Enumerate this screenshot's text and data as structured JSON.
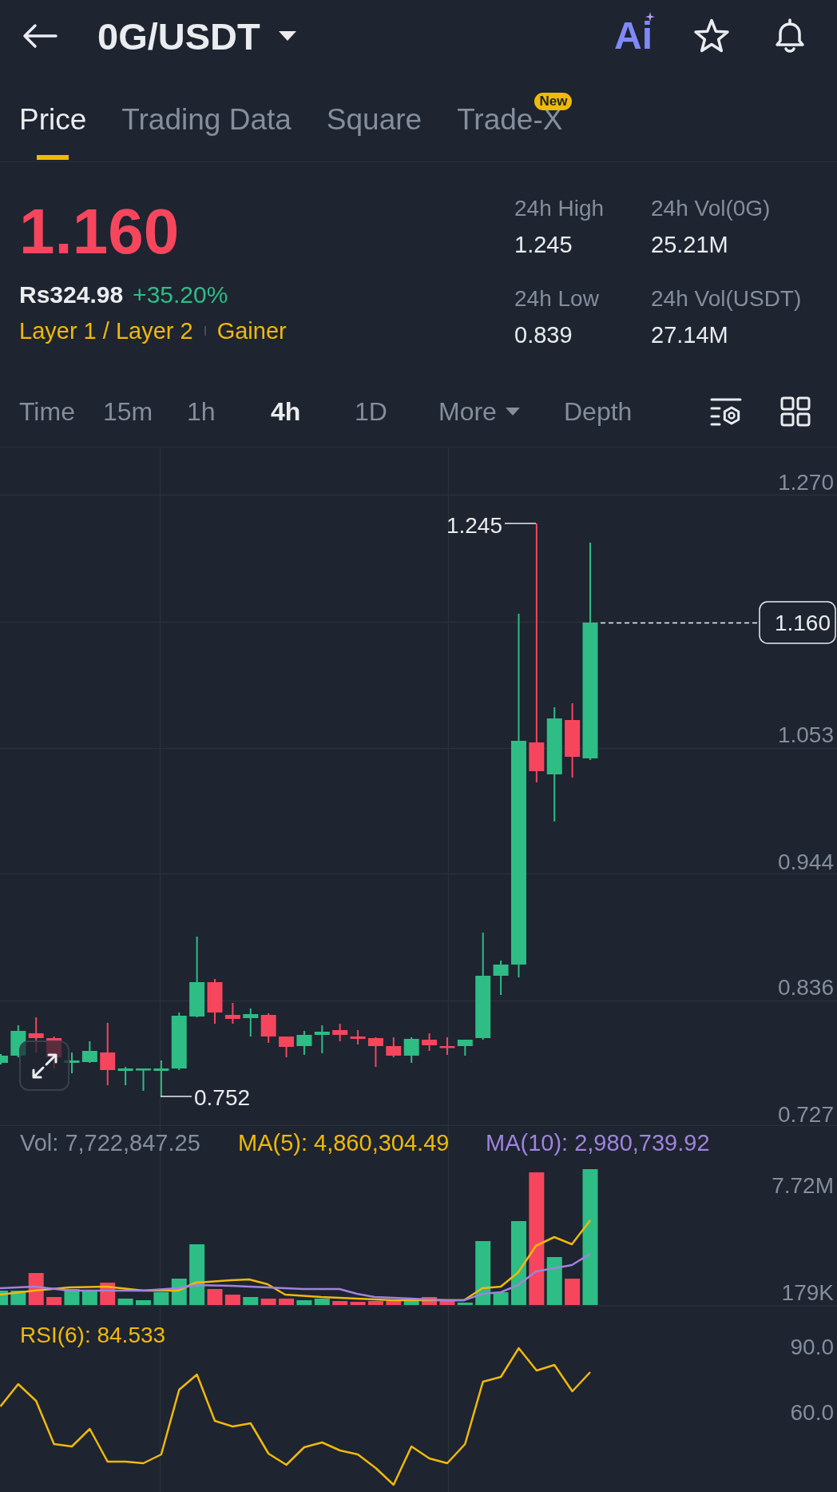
{
  "header": {
    "title": "0G/USDT",
    "ai_label": "Ai"
  },
  "tabs": [
    {
      "label": "Price",
      "selected": true
    },
    {
      "label": "Trading Data",
      "selected": false
    },
    {
      "label": "Square",
      "selected": false
    },
    {
      "label": "Trade-X",
      "selected": false,
      "badge": "New"
    }
  ],
  "ticker": {
    "price": "1.160",
    "local_price": "Rs324.98",
    "change": "+35.20%",
    "tags": [
      "Layer 1 / Layer 2",
      "Gainer"
    ],
    "stats": [
      {
        "label": "24h High",
        "value": "1.245"
      },
      {
        "label": "24h Vol(0G)",
        "value": "25.21M"
      },
      {
        "label": "24h Low",
        "value": "0.839"
      },
      {
        "label": "24h Vol(USDT)",
        "value": "27.14M"
      }
    ]
  },
  "intervals": [
    {
      "label": "Time",
      "kind": "option",
      "selected": false
    },
    {
      "label": "15m",
      "kind": "option",
      "selected": false
    },
    {
      "label": "1h",
      "kind": "option",
      "selected": false
    },
    {
      "label": "4h",
      "kind": "option",
      "selected": true
    },
    {
      "label": "1D",
      "kind": "option",
      "selected": false
    },
    {
      "label": "More",
      "kind": "menu",
      "selected": false
    },
    {
      "label": "Depth",
      "kind": "option",
      "selected": false
    }
  ],
  "price_chart": {
    "axis_labels": [
      "1.270",
      "1.053",
      "0.944",
      "0.836",
      "0.727"
    ],
    "high_label": "1.245",
    "low_label": "0.752",
    "last_price_label": "1.160"
  },
  "volume": {
    "indicators": [
      {
        "label": "Vol: 7,722,847.25",
        "color": "#848e9c"
      },
      {
        "label": "MA(5): 4,860,304.49",
        "color": "#f0b90b"
      },
      {
        "label": "MA(10): 2,980,739.92",
        "color": "#a083dd"
      }
    ],
    "axis_labels": [
      "7.72M",
      "179K"
    ]
  },
  "rsi": {
    "title": "RSI(6): 84.533",
    "axis_labels": [
      "90.0",
      "60.0"
    ]
  }
}
